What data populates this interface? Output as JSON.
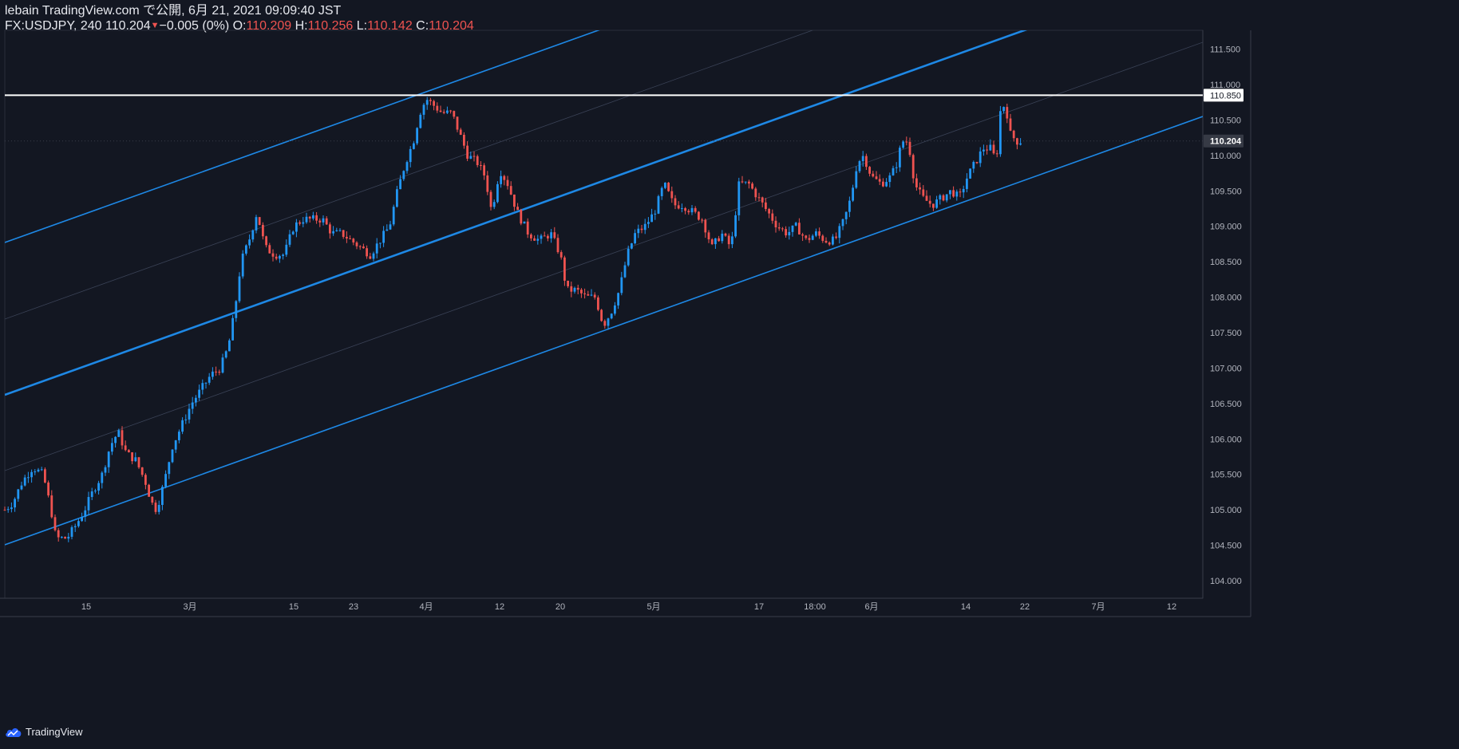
{
  "header": {
    "line1": "lebain TradingView.com で公開, 6月 21, 2021 09:09:40 JST",
    "symbol": "FX:USDJPY, 240",
    "last": "110.204",
    "change": "−0.005 (0%)",
    "o_label": "O:",
    "o": "110.209",
    "h_label": "H:",
    "h": "110.256",
    "l_label": "L:",
    "l": "110.142",
    "c_label": "C:",
    "c": "110.204"
  },
  "footer": {
    "brand": "TradingView"
  },
  "colors": {
    "background": "#131722",
    "up": "#2196f3",
    "down": "#ef5350",
    "channel": "#1e88e5",
    "resistance": "#ffffff",
    "axis_text": "#b2b5be"
  },
  "chart_data": {
    "type": "candlestick",
    "symbol": "FX:USDJPY",
    "interval": "240",
    "ylim": [
      103.8,
      111.9
    ],
    "y_ticks": [
      "111.500",
      "111.000",
      "110.500",
      "110.000",
      "109.500",
      "109.000",
      "108.500",
      "108.000",
      "107.500",
      "107.000",
      "106.500",
      "106.000",
      "105.500",
      "105.000",
      "104.500",
      "104.000"
    ],
    "x_ticks": [
      "15",
      "3月",
      "15",
      "23",
      "4月",
      "12",
      "20",
      "5月",
      "17",
      "18:00",
      "6月",
      "14",
      "22",
      "7月",
      "12"
    ],
    "price_labels": [
      {
        "value": "110.850",
        "style": "line"
      },
      {
        "value": "110.204",
        "style": "last"
      }
    ],
    "horizontal_line": 110.85,
    "last_price": 110.204,
    "price_path": [
      [
        0,
        105.0
      ],
      [
        10,
        105.1
      ],
      [
        22,
        105.4
      ],
      [
        35,
        105.6
      ],
      [
        48,
        105.5
      ],
      [
        58,
        105.0
      ],
      [
        64,
        104.6
      ],
      [
        78,
        104.6
      ],
      [
        90,
        104.8
      ],
      [
        100,
        105.0
      ],
      [
        112,
        105.3
      ],
      [
        122,
        105.5
      ],
      [
        132,
        105.9
      ],
      [
        142,
        106.1
      ],
      [
        152,
        105.8
      ],
      [
        164,
        105.7
      ],
      [
        176,
        105.4
      ],
      [
        184,
        105.1
      ],
      [
        190,
        105.0
      ],
      [
        200,
        105.4
      ],
      [
        210,
        105.9
      ],
      [
        222,
        106.2
      ],
      [
        234,
        106.5
      ],
      [
        246,
        106.7
      ],
      [
        258,
        106.9
      ],
      [
        270,
        107.0
      ],
      [
        280,
        107.3
      ],
      [
        288,
        107.8
      ],
      [
        296,
        108.5
      ],
      [
        306,
        108.8
      ],
      [
        316,
        109.2
      ],
      [
        326,
        108.7
      ],
      [
        338,
        108.6
      ],
      [
        350,
        108.6
      ],
      [
        362,
        109.0
      ],
      [
        374,
        109.1
      ],
      [
        386,
        109.1
      ],
      [
        398,
        109.1
      ],
      [
        410,
        108.9
      ],
      [
        422,
        108.9
      ],
      [
        434,
        108.8
      ],
      [
        446,
        108.7
      ],
      [
        458,
        108.6
      ],
      [
        470,
        108.8
      ],
      [
        482,
        109.0
      ],
      [
        492,
        109.5
      ],
      [
        502,
        109.9
      ],
      [
        512,
        110.2
      ],
      [
        520,
        110.6
      ],
      [
        528,
        110.8
      ],
      [
        538,
        110.7
      ],
      [
        548,
        110.6
      ],
      [
        560,
        110.6
      ],
      [
        570,
        110.3
      ],
      [
        580,
        110.0
      ],
      [
        592,
        109.9
      ],
      [
        602,
        109.7
      ],
      [
        610,
        109.2
      ],
      [
        620,
        109.8
      ],
      [
        630,
        109.6
      ],
      [
        642,
        109.2
      ],
      [
        656,
        108.9
      ],
      [
        670,
        108.8
      ],
      [
        684,
        108.9
      ],
      [
        696,
        108.6
      ],
      [
        704,
        108.1
      ],
      [
        716,
        108.1
      ],
      [
        728,
        108.0
      ],
      [
        740,
        108.0
      ],
      [
        750,
        107.6
      ],
      [
        760,
        107.8
      ],
      [
        770,
        108.1
      ],
      [
        780,
        108.6
      ],
      [
        790,
        108.9
      ],
      [
        802,
        109.0
      ],
      [
        814,
        109.2
      ],
      [
        826,
        109.6
      ],
      [
        838,
        109.3
      ],
      [
        850,
        109.3
      ],
      [
        862,
        109.2
      ],
      [
        874,
        109.1
      ],
      [
        886,
        108.7
      ],
      [
        898,
        108.9
      ],
      [
        910,
        108.7
      ],
      [
        920,
        109.6
      ],
      [
        932,
        109.6
      ],
      [
        944,
        109.4
      ],
      [
        956,
        109.2
      ],
      [
        968,
        109.0
      ],
      [
        980,
        108.9
      ],
      [
        992,
        109.0
      ],
      [
        1004,
        108.8
      ],
      [
        1016,
        108.9
      ],
      [
        1028,
        108.8
      ],
      [
        1040,
        108.8
      ],
      [
        1052,
        109.1
      ],
      [
        1060,
        109.4
      ],
      [
        1068,
        109.9
      ],
      [
        1076,
        110.0
      ],
      [
        1086,
        109.7
      ],
      [
        1098,
        109.6
      ],
      [
        1110,
        109.7
      ],
      [
        1118,
        109.9
      ],
      [
        1124,
        110.2
      ],
      [
        1132,
        110.2
      ],
      [
        1140,
        109.6
      ],
      [
        1150,
        109.4
      ],
      [
        1162,
        109.3
      ],
      [
        1174,
        109.4
      ],
      [
        1186,
        109.5
      ],
      [
        1196,
        109.4
      ],
      [
        1206,
        109.7
      ],
      [
        1216,
        109.9
      ],
      [
        1226,
        110.1
      ],
      [
        1236,
        110.1
      ],
      [
        1242,
        109.9
      ],
      [
        1248,
        110.7
      ],
      [
        1254,
        110.7
      ],
      [
        1260,
        110.3
      ],
      [
        1268,
        110.2
      ],
      [
        1274,
        110.2
      ]
    ]
  }
}
